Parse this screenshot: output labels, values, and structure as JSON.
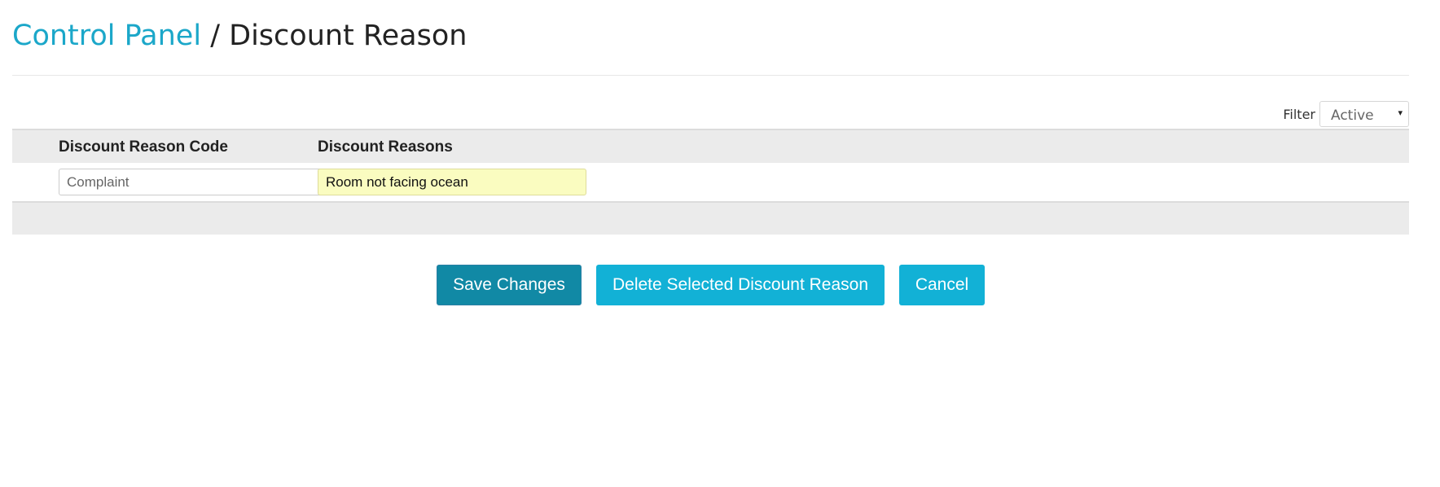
{
  "breadcrumb": {
    "parent": "Control Panel",
    "separator": " / ",
    "current": "Discount Reason"
  },
  "filter": {
    "label": "Filter",
    "selected": "Active",
    "caret": "▾"
  },
  "table": {
    "columns": [
      "Discount Reason Code",
      "Discount Reasons"
    ],
    "rows": [
      {
        "code": "Complaint",
        "reason": "Room not facing ocean"
      }
    ]
  },
  "actions": {
    "save_label": "Save Changes",
    "delete_label": "Delete Selected Discount Reason",
    "cancel_label": "Cancel"
  },
  "colors": {
    "link": "#1ba7c9",
    "primary_button": "#12b1d6",
    "save_button": "#1189a5",
    "highlight_input": "#fafcc0",
    "table_header_bg": "#ebebeb"
  }
}
